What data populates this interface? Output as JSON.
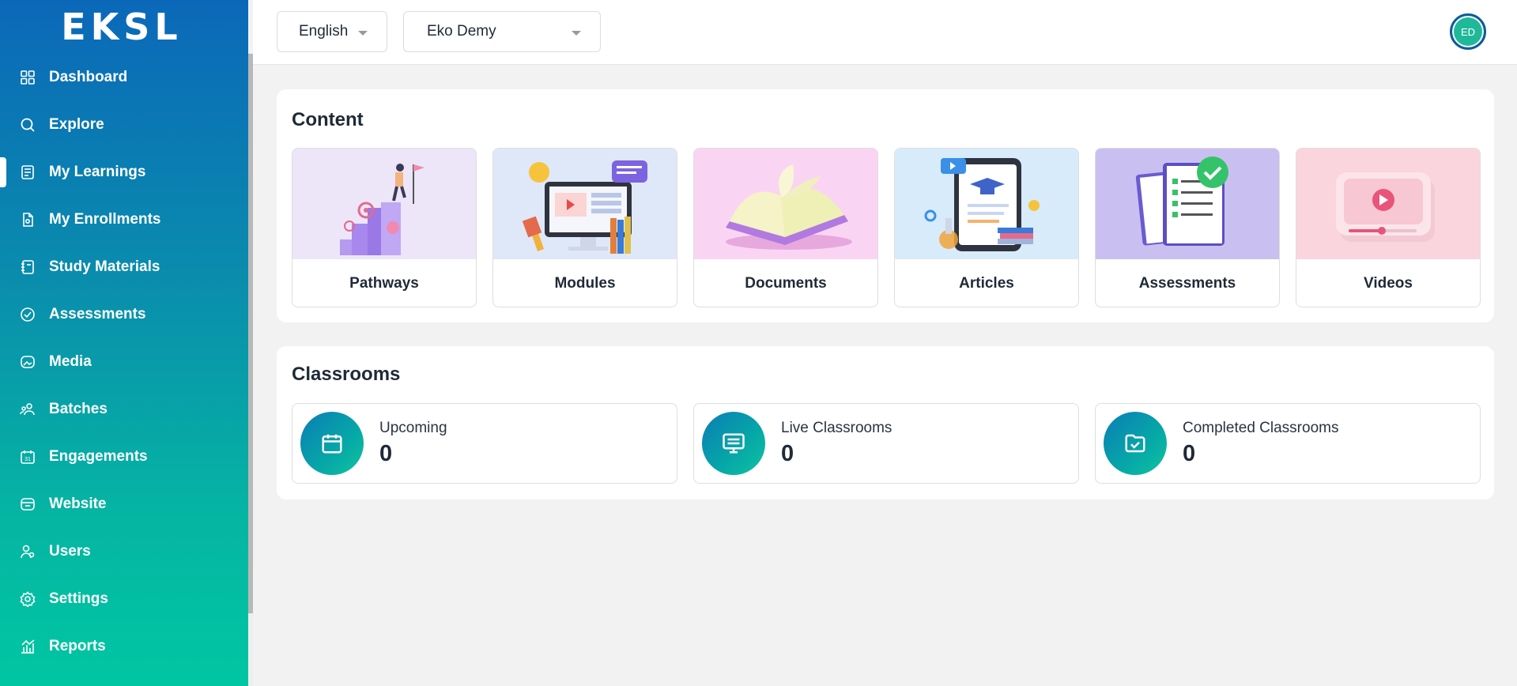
{
  "app": {
    "logo": "EKSL"
  },
  "sidebar": {
    "items": [
      {
        "label": "Dashboard",
        "icon": "grid-icon"
      },
      {
        "label": "Explore",
        "icon": "search-icon"
      },
      {
        "label": "My Learnings",
        "icon": "book-icon",
        "active": true
      },
      {
        "label": "My Enrollments",
        "icon": "file-icon"
      },
      {
        "label": "Study Materials",
        "icon": "notebook-icon"
      },
      {
        "label": "Assessments",
        "icon": "checklist-icon"
      },
      {
        "label": "Media",
        "icon": "media-icon"
      },
      {
        "label": "Batches",
        "icon": "group-icon"
      },
      {
        "label": "Engagements",
        "icon": "calendar-icon"
      },
      {
        "label": "Website",
        "icon": "browser-icon"
      },
      {
        "label": "Users",
        "icon": "users-icon"
      },
      {
        "label": "Settings",
        "icon": "gear-icon"
      },
      {
        "label": "Reports",
        "icon": "chart-icon"
      }
    ]
  },
  "header": {
    "language": "English",
    "organization": "Eko Demy",
    "avatar_initials": "ED"
  },
  "content": {
    "title": "Content",
    "tiles": [
      {
        "label": "Pathways",
        "bg": "#ece6f8"
      },
      {
        "label": "Modules",
        "bg": "#dfe8f8"
      },
      {
        "label": "Documents",
        "bg": "#f9d5f3"
      },
      {
        "label": "Articles",
        "bg": "#d8ebfb"
      },
      {
        "label": "Assessments",
        "bg": "#c9c0f1"
      },
      {
        "label": "Videos",
        "bg": "#fbd5de"
      }
    ]
  },
  "classrooms": {
    "title": "Classrooms",
    "stats": [
      {
        "label": "Upcoming",
        "value": "0",
        "icon": "calendar-icon"
      },
      {
        "label": "Live Classrooms",
        "value": "0",
        "icon": "monitor-icon"
      },
      {
        "label": "Completed Classrooms",
        "value": "0",
        "icon": "folder-check-icon"
      }
    ]
  },
  "colors": {
    "sidebar_top": "#0b68b9",
    "sidebar_bottom": "#00c6a2",
    "accent": "#0a8cad"
  }
}
